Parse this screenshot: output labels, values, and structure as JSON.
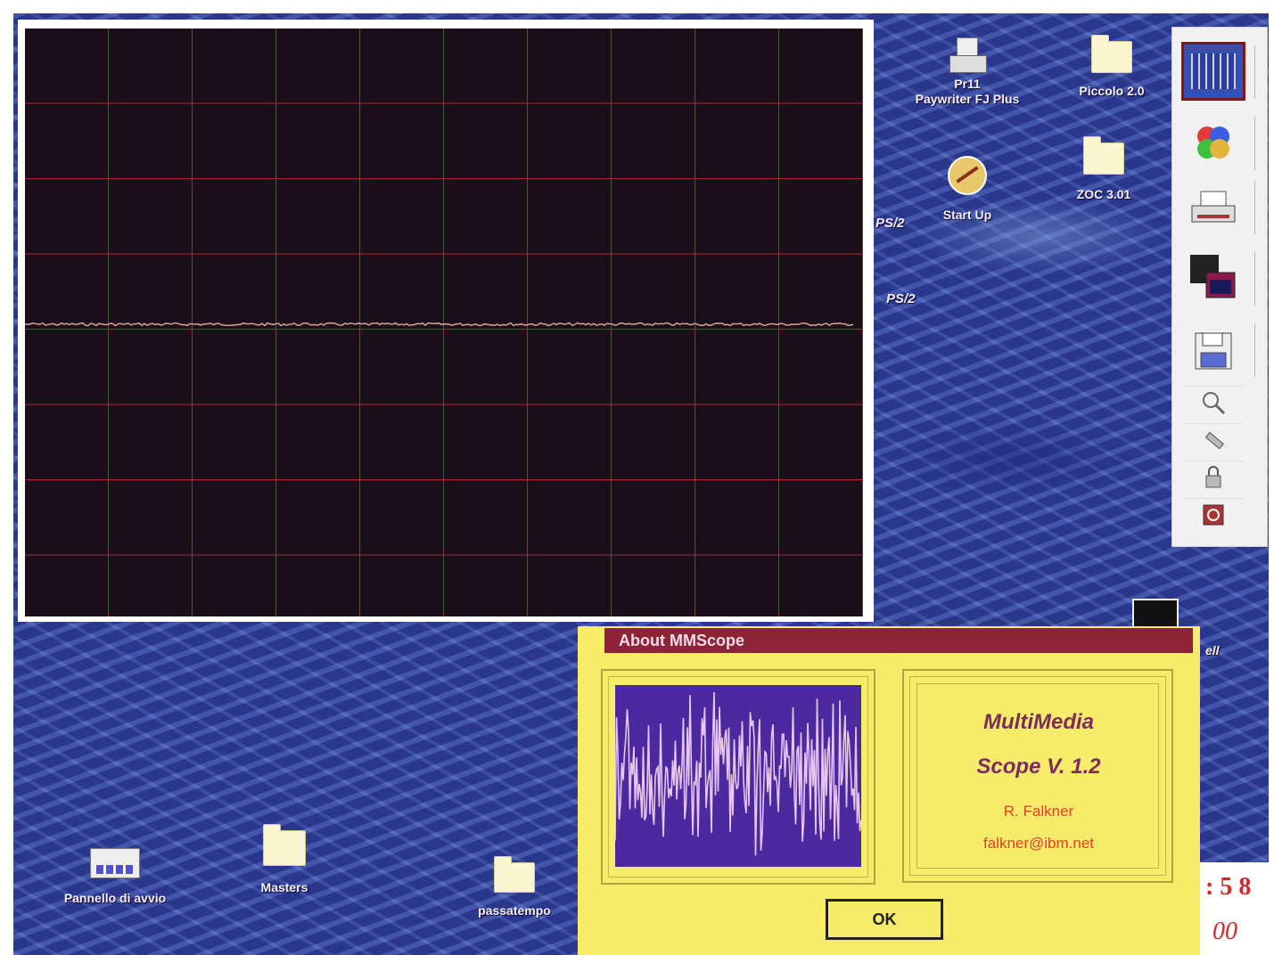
{
  "desktop": {
    "icons": [
      {
        "id": "paywriter",
        "lines": [
          "Pr11",
          "Paywriter FJ Plus"
        ]
      },
      {
        "id": "piccolo",
        "lines": [
          "Piccolo 2.0"
        ]
      },
      {
        "id": "startup",
        "lines": [
          "Start Up"
        ]
      },
      {
        "id": "zoc",
        "lines": [
          "ZOC 3.01"
        ]
      },
      {
        "id": "pannello",
        "lines": [
          "Pannello di avvio"
        ]
      },
      {
        "id": "masters",
        "lines": [
          "Masters"
        ]
      },
      {
        "id": "passatempo",
        "lines": [
          "passatempo"
        ]
      }
    ],
    "partial_labels": [
      "PS/2",
      "PS/2",
      "ell",
      "00"
    ]
  },
  "about_dialog": {
    "title": "About MMScope",
    "product_line1": "MultiMedia",
    "product_line2": "Scope V. 1.2",
    "author": "R. Falkner",
    "email": "falkner@ibm.net",
    "ok_label": "OK"
  },
  "clock": {
    "time_fragment": ": 5 8"
  },
  "colors": {
    "grid": "#c8283c",
    "dialog_bg": "#f6ec6a",
    "titlebar": "#8d2338",
    "screen": "#1b0f1a"
  }
}
